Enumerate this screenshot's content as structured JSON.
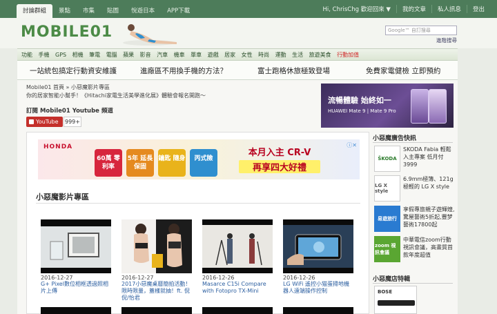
{
  "topbar": {
    "tabs": [
      "討論群組",
      "景點",
      "市集",
      "貼圖",
      "悅遊日本",
      "APP下載"
    ],
    "user_menu": [
      "Hi, ChrisChg 歡迎回來 ▼",
      "我的文章",
      "私人訊息",
      "登出"
    ]
  },
  "header": {
    "logo": "MOBILE01",
    "search_placeholder": "Google™ 自訂搜尋",
    "search_link": "進階搜尋"
  },
  "nav": {
    "items": [
      "功能",
      "手機",
      "GPS",
      "相機",
      "筆電",
      "電腦",
      "蘋果",
      "影音",
      "汽車",
      "機車",
      "單車",
      "遊戲",
      "居家",
      "女性",
      "時尚",
      "運動",
      "生活",
      "旅遊美食",
      "行動加值"
    ]
  },
  "promos": [
    "一站統包搞定行動資安維護",
    "進廠區不用換手機的方法？",
    "富士跑格休旅極致登場",
    "免費家電健檢 立即預約"
  ],
  "content": {
    "breadcrumb": "Mobile01 首頁 » 小惡魔影片專區",
    "subtext": "你的居家智能小幫手！《Hitachi家電生活美學進化展》體驗會報名開跑～",
    "subscribe": "訂閱 Mobile01 Youtube 頻道",
    "youtube_label": "YouTube",
    "youtube_count": "999+"
  },
  "huawei_ad": {
    "headline": "流暢體驗 始終如一",
    "sub": "HUAWEI Mate 9 | Mate 9 Pro"
  },
  "honda_ad": {
    "brand": "HONDA",
    "badges": [
      "60萬 零利率",
      "5年 延長保固",
      "鑰匙 隨身",
      "丙式險"
    ],
    "headline1": "本月入主 CR-V",
    "headline2": "再享四大好禮"
  },
  "section_title": "小惡魔影片專區",
  "videos": [
    {
      "date": "2016-12-27",
      "title": "G+ Pixel數位相框透過照相片上傳"
    },
    {
      "date": "2016-12-27",
      "title": "2017小惡魔桌曆簡拍活動！限時限量，蓋樣就抽！ft. 倪倪/怡君"
    },
    {
      "date": "2016-12-26",
      "title": "Masarce C15i Compare with Fotopro TX-Mini"
    },
    {
      "date": "2016-12-26",
      "title": "LG WiFi 遙控小猫蛋掃地機器人遠端操作控制"
    }
  ],
  "sidebar": {
    "title1": "小惡魔廣告快訊",
    "items": [
      {
        "logo": "ŠKODA",
        "text": "SKODA Fabia 輕鬆入主專案 低月付3999"
      },
      {
        "logo": "LG X style",
        "text": "6.9mm極簿、121g極輕的 LG X style"
      },
      {
        "logo": "易遊旅行",
        "text": "享假專旅親子遊輝煌,驚屋藝術5折起,豐梦藝術17800起"
      },
      {
        "logo": "zoom 視訊會議",
        "text": "中華電信zoom行動視訊會議，高畫質首款年度超值"
      }
    ],
    "title2": "小惡魔店特輯",
    "bose": "BOSE"
  },
  "colors": {
    "topbar": "#4d7c5a",
    "logo_green": "#4c8b47",
    "youtube_red": "#c4302b",
    "link_blue": "#2a5d9f"
  }
}
